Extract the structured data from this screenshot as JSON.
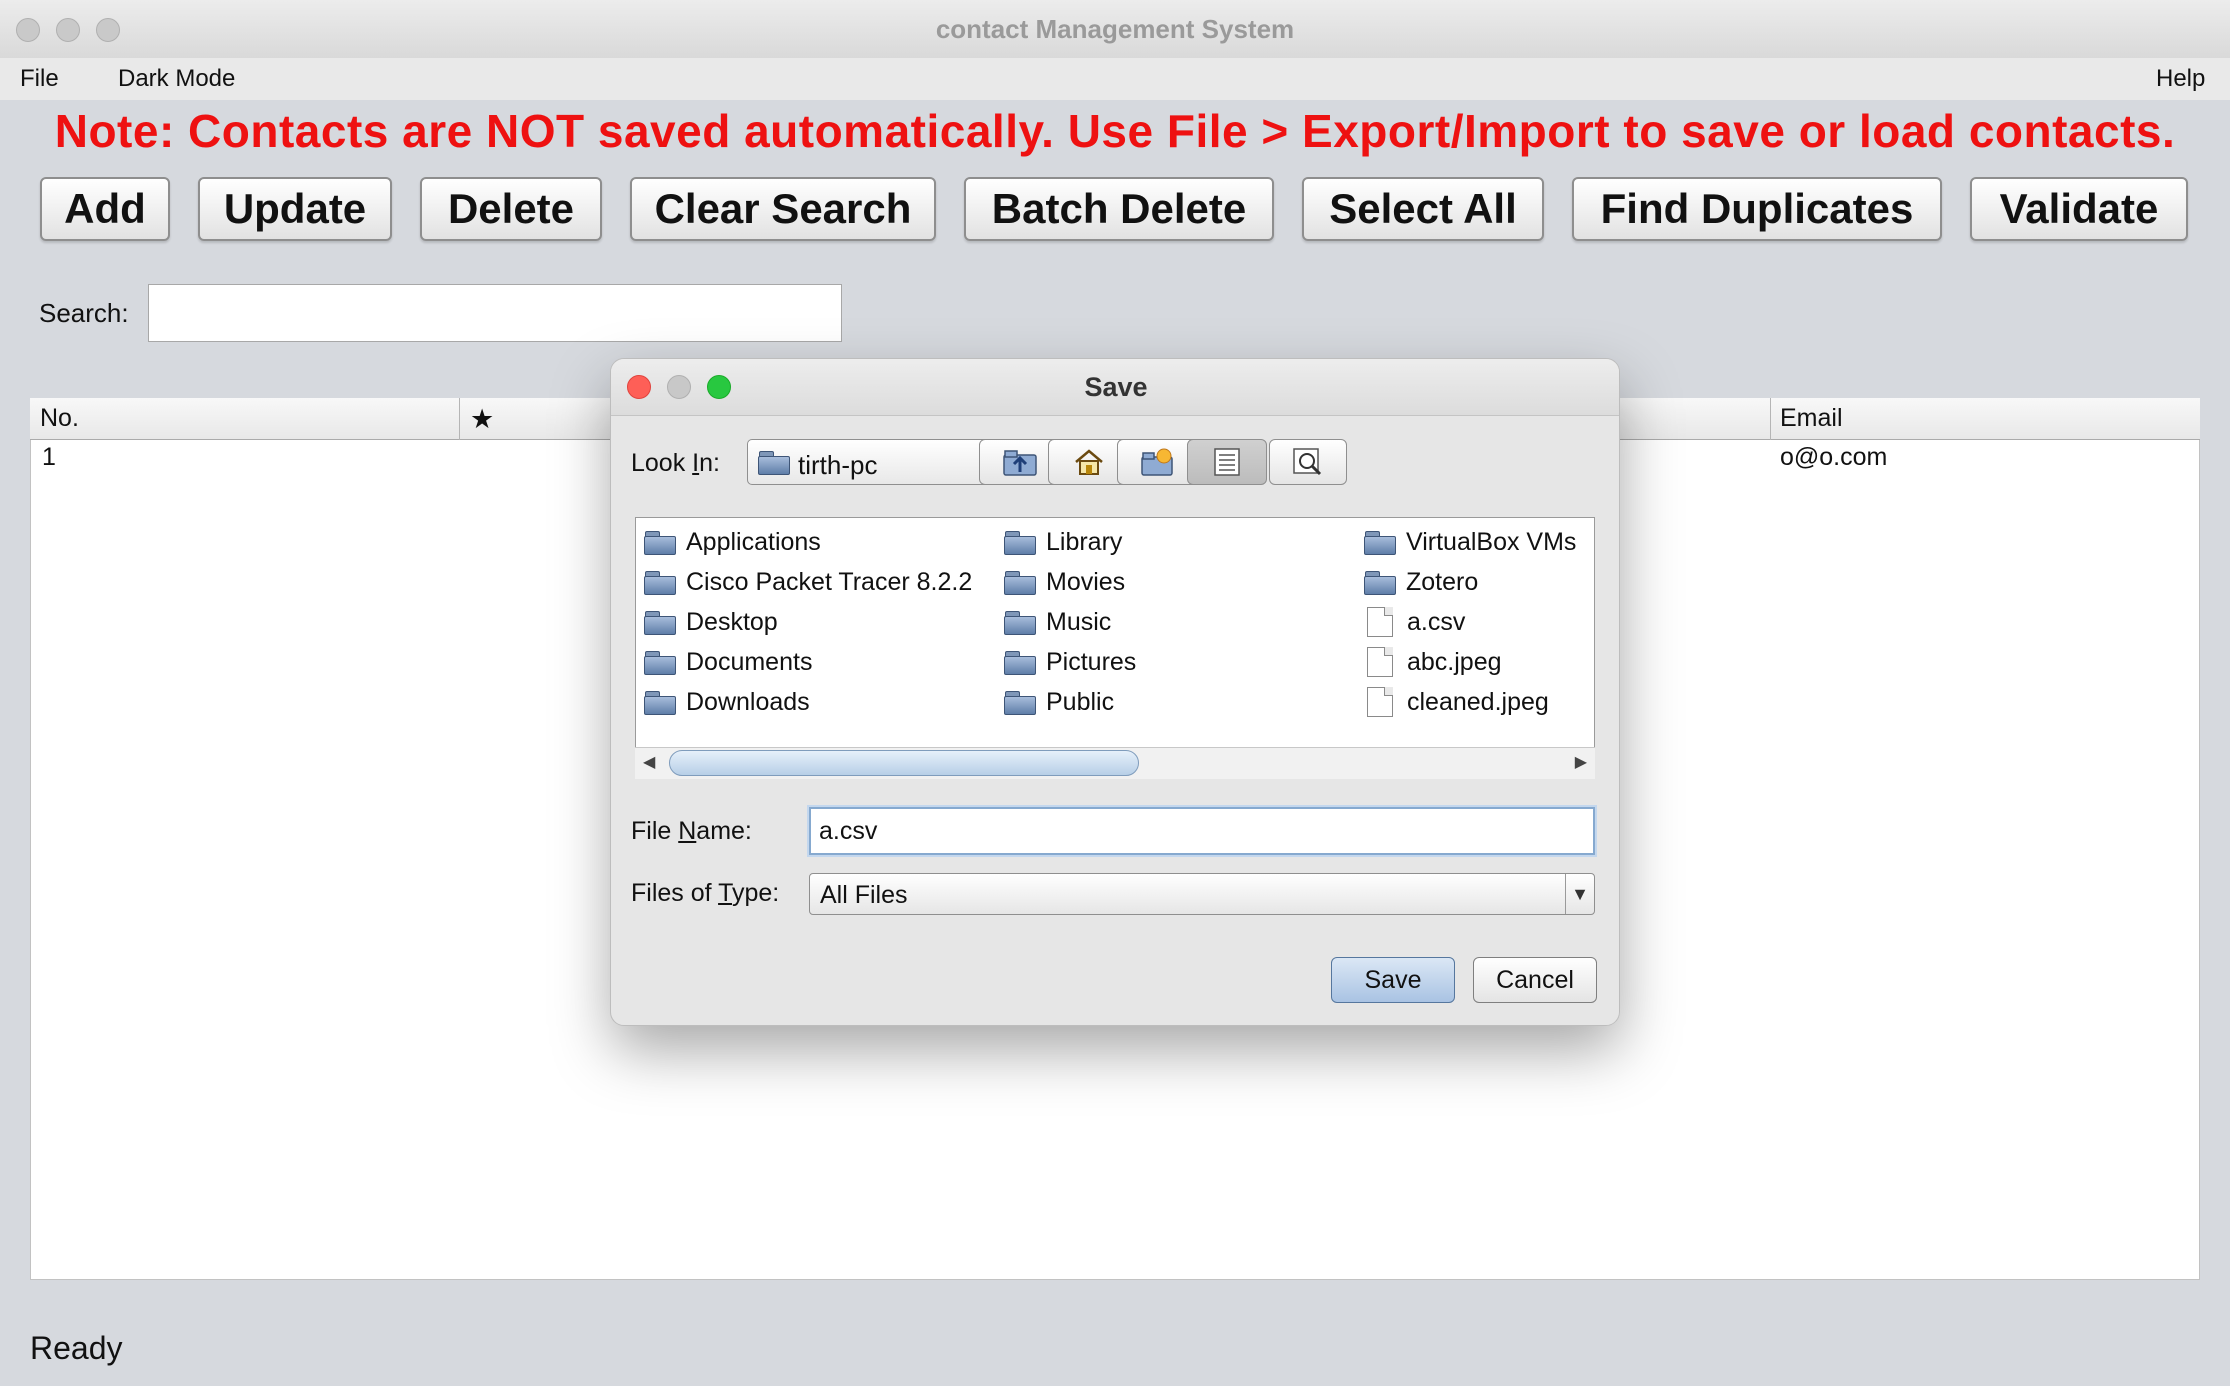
{
  "window": {
    "title": "contact Management System"
  },
  "menubar": {
    "file": "File",
    "dark_mode": "Dark Mode",
    "help": "Help"
  },
  "note": "Note: Contacts are NOT saved automatically. Use File > Export/Import to save or load contacts.",
  "toolbar": {
    "add": "Add",
    "update": "Update",
    "delete": "Delete",
    "clear_search": "Clear Search",
    "batch_delete": "Batch Delete",
    "select_all": "Select All",
    "find_duplicates": "Find Duplicates",
    "validate": "Validate"
  },
  "search": {
    "label": "Search:",
    "value": ""
  },
  "table": {
    "columns": [
      "No.",
      "★",
      "Email"
    ],
    "rows": [
      {
        "no": "1",
        "email": "o@o.com"
      }
    ]
  },
  "status": "Ready",
  "dialog": {
    "title": "Save",
    "look_in": {
      "pre": "Look ",
      "key": "I",
      "post": "n:",
      "value": "tirth-pc"
    },
    "files": [
      {
        "name": "Applications",
        "type": "folder"
      },
      {
        "name": "Cisco Packet Tracer 8.2.2",
        "type": "folder"
      },
      {
        "name": "Desktop",
        "type": "folder"
      },
      {
        "name": "Documents",
        "type": "folder"
      },
      {
        "name": "Downloads",
        "type": "folder"
      },
      {
        "name": "Library",
        "type": "folder"
      },
      {
        "name": "Movies",
        "type": "folder"
      },
      {
        "name": "Music",
        "type": "folder"
      },
      {
        "name": "Pictures",
        "type": "folder"
      },
      {
        "name": "Public",
        "type": "folder"
      },
      {
        "name": "VirtualBox VMs",
        "type": "folder"
      },
      {
        "name": "Zotero",
        "type": "folder"
      },
      {
        "name": "a.csv",
        "type": "file"
      },
      {
        "name": "abc.jpeg",
        "type": "file"
      },
      {
        "name": "cleaned.jpeg",
        "type": "file"
      }
    ],
    "file_name": {
      "pre": "File ",
      "key": "N",
      "post": "ame:",
      "value": "a.csv"
    },
    "file_type": {
      "pre": "Files of ",
      "key": "T",
      "post": "ype:",
      "value": "All Files"
    },
    "save_button": "Save",
    "cancel_button": "Cancel"
  },
  "colors": {
    "note_red": "#ee1111",
    "close_red": "#fe5f57",
    "minimize_gray": "#c8c8c8",
    "zoom_green": "#28c840"
  }
}
